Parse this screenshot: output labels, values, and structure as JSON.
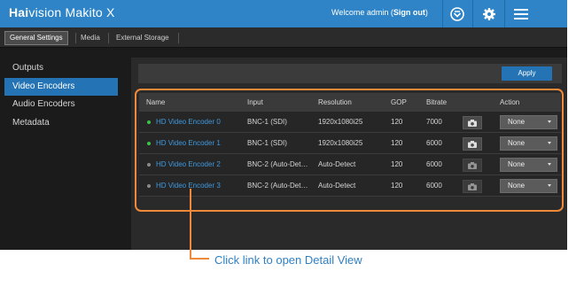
{
  "app": {
    "brand_prefix": "Hai",
    "brand_rest": "vision Makito X",
    "welcome_text": "Welcome admin (",
    "signout_label": "Sign out",
    "welcome_suffix": ")"
  },
  "toolbar_icons": [
    "refresh-icon",
    "gear-icon",
    "menu-icon"
  ],
  "tabs": [
    {
      "label": "General Settings",
      "active": true
    },
    {
      "label": "Media",
      "active": false
    },
    {
      "label": "External Storage",
      "active": false
    }
  ],
  "sidebar": {
    "items": [
      {
        "label": "Outputs",
        "active": false
      },
      {
        "label": "Video Encoders",
        "active": true
      },
      {
        "label": "Audio Encoders",
        "active": false
      },
      {
        "label": "Metadata",
        "active": false
      }
    ]
  },
  "apply_label": "Apply",
  "table": {
    "headers": {
      "name": "Name",
      "input": "Input",
      "resolution": "Resolution",
      "gop": "GOP",
      "bitrate": "Bitrate",
      "action": "Action"
    },
    "rows": [
      {
        "name": "HD Video Encoder 0",
        "input": "BNC-1 (SDI)",
        "resolution": "1920x1080i25",
        "gop": "120",
        "bitrate": "7000",
        "action": "None",
        "status_color": "#3cc24a"
      },
      {
        "name": "HD Video Encoder 1",
        "input": "BNC-1 (SDI)",
        "resolution": "1920x1080i25",
        "gop": "120",
        "bitrate": "6000",
        "action": "None",
        "status_color": "#3cc24a"
      },
      {
        "name": "HD Video Encoder 2",
        "input": "BNC-2 (Auto-Det…",
        "resolution": "Auto-Detect",
        "gop": "120",
        "bitrate": "6000",
        "action": "None",
        "status_color": "#8a8a8a"
      },
      {
        "name": "HD Video Encoder 3",
        "input": "BNC-2 (Auto-Det…",
        "resolution": "Auto-Detect",
        "gop": "120",
        "bitrate": "6000",
        "action": "None",
        "status_color": "#8a8a8a"
      }
    ]
  },
  "callout": {
    "text": "Click link to open Detail View"
  },
  "colors": {
    "accent": "#2e84c6",
    "highlight": "#f08a3a",
    "link": "#3f9ae0"
  }
}
